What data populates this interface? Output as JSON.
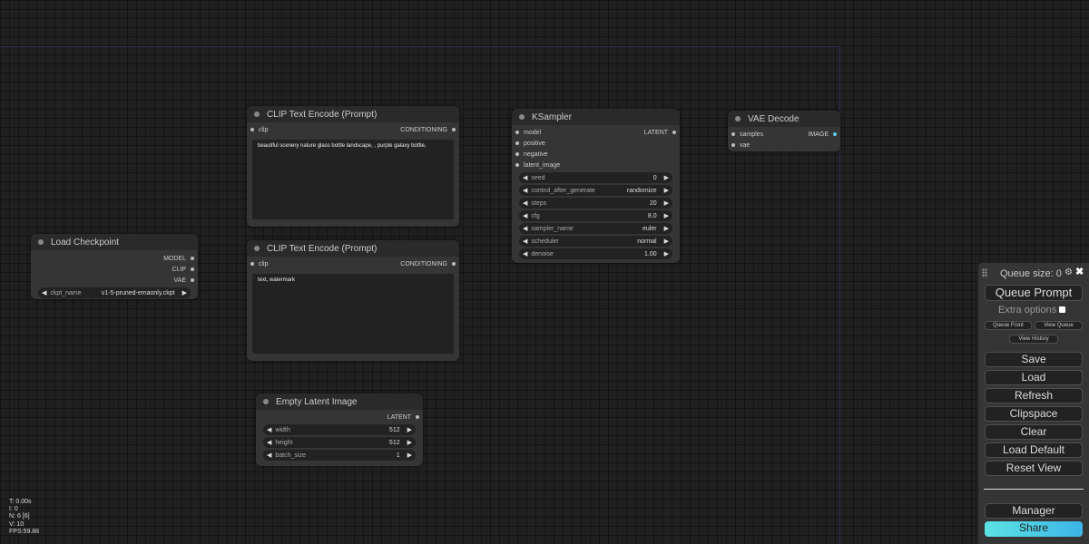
{
  "nodes": {
    "load_checkpoint": {
      "title": "Load Checkpoint",
      "outputs": [
        "MODEL",
        "CLIP",
        "VAE"
      ],
      "widget": {
        "name": "ckpt_name",
        "value": "v1-5-pruned-emaonly.ckpt"
      }
    },
    "clip_text_encode_1": {
      "title": "CLIP Text Encode (Prompt)",
      "input": "clip",
      "output": "CONDITIONING",
      "text": "beautiful scenery nature glass bottle landscape, , purple galaxy bottle,"
    },
    "clip_text_encode_2": {
      "title": "CLIP Text Encode (Prompt)",
      "input": "clip",
      "output": "CONDITIONING",
      "text": "text, watermark"
    },
    "empty_latent": {
      "title": "Empty Latent Image",
      "output": "LATENT",
      "widgets": [
        {
          "name": "width",
          "value": "512"
        },
        {
          "name": "height",
          "value": "512"
        },
        {
          "name": "batch_size",
          "value": "1"
        }
      ]
    },
    "ksampler": {
      "title": "KSampler",
      "inputs": [
        "model",
        "positive",
        "negative",
        "latent_image"
      ],
      "output": "LATENT",
      "widgets": [
        {
          "name": "seed",
          "value": "0"
        },
        {
          "name": "control_after_generate",
          "value": "randomize"
        },
        {
          "name": "steps",
          "value": "20"
        },
        {
          "name": "cfg",
          "value": "8.0"
        },
        {
          "name": "sampler_name",
          "value": "euler"
        },
        {
          "name": "scheduler",
          "value": "normal"
        },
        {
          "name": "denoise",
          "value": "1.00"
        }
      ]
    },
    "vae_decode": {
      "title": "VAE Decode",
      "inputs": [
        "samples",
        "vae"
      ],
      "output": "IMAGE"
    }
  },
  "stats": [
    "T: 0.00s",
    "I: 0",
    "N: 6 [6]",
    "V: 10",
    "FPS:59.88"
  ],
  "menu": {
    "queue_size": "Queue size: 0",
    "queue_prompt": "Queue Prompt",
    "extra_options": "Extra options",
    "queue_front": "Queue Front",
    "view_queue": "View Queue",
    "view_history": "View History",
    "save": "Save",
    "load": "Load",
    "refresh": "Refresh",
    "clipspace": "Clipspace",
    "clear": "Clear",
    "load_default": "Load Default",
    "reset_view": "Reset View",
    "manager": "Manager",
    "share": "Share"
  },
  "glyphs": {
    "left": "◀",
    "right": "▶",
    "gear": "⚙",
    "close": "✖"
  },
  "colors": {
    "image_output_dot": "#5bc8e8",
    "share_gradient_start": "#5be3e3"
  }
}
